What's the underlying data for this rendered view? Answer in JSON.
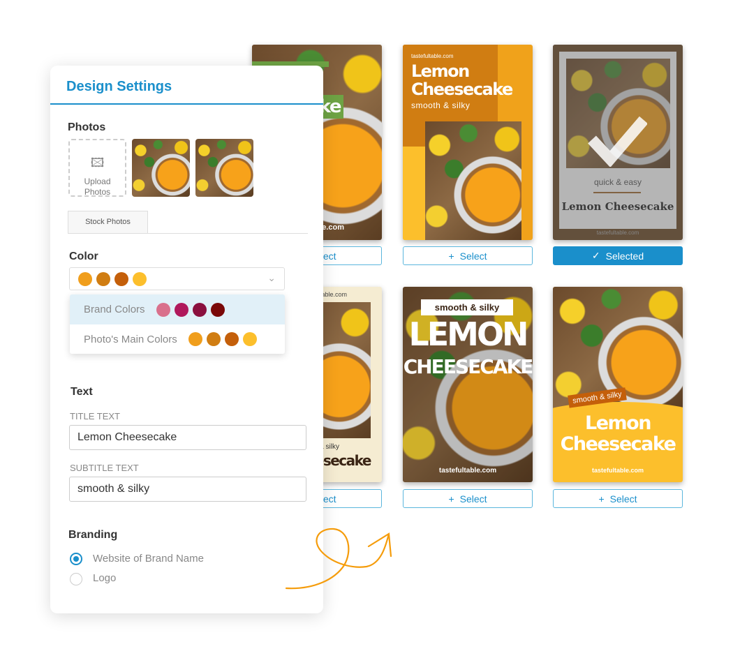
{
  "panel": {
    "title": "Design Settings",
    "photos": {
      "heading": "Photos",
      "upload_label": "Upload Photos",
      "stock_tab": "Stock Photos"
    },
    "color": {
      "heading": "Color",
      "selected": [
        "#f09e1c",
        "#d07d12",
        "#c45f0a",
        "#fcbf2c"
      ],
      "options": [
        {
          "label": "Brand Colors",
          "colors": [
            "#d9708c",
            "#b0185c",
            "#8a0f3e",
            "#7a0808"
          ]
        },
        {
          "label": "Photo's Main Colors",
          "colors": [
            "#f09e1c",
            "#d07d12",
            "#c45f0a",
            "#fcbf2c"
          ]
        }
      ]
    },
    "text": {
      "heading": "Text",
      "title_label": "TITLE TEXT",
      "title_value": "Lemon Cheesecake",
      "subtitle_label": "SUBTITLE TEXT",
      "subtitle_value": "smooth & silky"
    },
    "branding": {
      "heading": "Branding",
      "options": [
        {
          "label": "Website of Brand Name",
          "checked": true
        },
        {
          "label": "Logo",
          "checked": false
        }
      ]
    }
  },
  "cards": {
    "site": "tastefultable.com",
    "title": "Lemon Cheesecake",
    "title_line1": "Lemon",
    "title_line2": "Cheesecake",
    "title_upper1": "LEMON",
    "title_upper2": "CHEESECAKE",
    "subtitle": "smooth & silky",
    "subtitle_alt": "quick & easy",
    "select_label": "Select",
    "selected_label": "Selected"
  },
  "colors": {
    "accent": "#1a8fcb",
    "arrow": "#f59c0b"
  }
}
